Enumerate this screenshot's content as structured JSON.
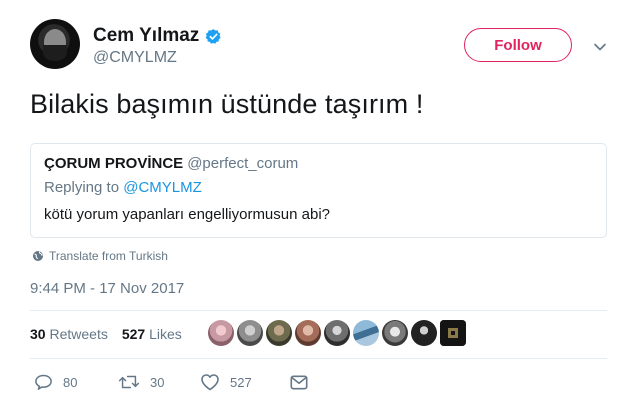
{
  "author": {
    "display_name": "Cem Yılmaz",
    "handle": "@CMYLMZ",
    "verified_icon": "verified-badge-icon",
    "accent": "#1da1f2"
  },
  "follow": {
    "label": "Follow",
    "color": "#e0245e"
  },
  "tweet": {
    "text": "Bilakis başımın üstünde taşırım !",
    "translate_label": "Translate from Turkish",
    "timestamp": "9:44 PM - 17 Nov 2017"
  },
  "quoted": {
    "name": "ÇORUM PROVİNCE",
    "handle": "@perfect_corum",
    "replying_prefix": "Replying to",
    "replying_to": "@CMYLMZ",
    "text": "kötü yorum yapanları engelliyormusun abi?"
  },
  "stats": {
    "retweets_count": "30",
    "retweets_label": "Retweets",
    "likes_count": "527",
    "likes_label": "Likes",
    "liker_avatars": 9
  },
  "actions": {
    "reply_count": "80",
    "retweet_count": "30",
    "like_count": "527"
  }
}
